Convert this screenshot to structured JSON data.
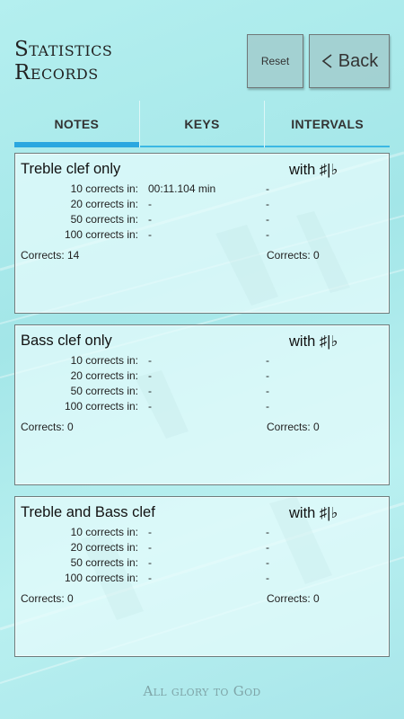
{
  "header": {
    "title_line1": "Statistics",
    "title_line2": "Records",
    "reset_label": "Reset",
    "back_label": "Back"
  },
  "tabs": [
    {
      "label": "NOTES",
      "active": true
    },
    {
      "label": "KEYS",
      "active": false
    },
    {
      "label": "INTERVALS",
      "active": false
    }
  ],
  "cards": [
    {
      "title": "Treble clef only",
      "with_label": "with ♯|♭",
      "rows": [
        {
          "label": "10 corrects in:",
          "plain": "00:11.104 min",
          "accidental": "-"
        },
        {
          "label": "20 corrects in:",
          "plain": "-",
          "accidental": "-"
        },
        {
          "label": "50 corrects in:",
          "plain": "-",
          "accidental": "-"
        },
        {
          "label": "100 corrects in:",
          "plain": "-",
          "accidental": "-"
        }
      ],
      "corrects_plain": "Corrects:  14",
      "corrects_accidental": "Corrects:  0"
    },
    {
      "title": "Bass clef only",
      "with_label": "with ♯|♭",
      "rows": [
        {
          "label": "10 corrects in:",
          "plain": "-",
          "accidental": "-"
        },
        {
          "label": "20 corrects in:",
          "plain": "-",
          "accidental": "-"
        },
        {
          "label": "50 corrects in:",
          "plain": "-",
          "accidental": "-"
        },
        {
          "label": "100 corrects in:",
          "plain": "-",
          "accidental": "-"
        }
      ],
      "corrects_plain": "Corrects:  0",
      "corrects_accidental": "Corrects:  0"
    },
    {
      "title": "Treble and Bass clef",
      "with_label": "with ♯|♭",
      "rows": [
        {
          "label": "10 corrects in:",
          "plain": "-",
          "accidental": "-"
        },
        {
          "label": "20 corrects in:",
          "plain": "-",
          "accidental": "-"
        },
        {
          "label": "50 corrects in:",
          "plain": "-",
          "accidental": "-"
        },
        {
          "label": "100 corrects in:",
          "plain": "-",
          "accidental": "-"
        }
      ],
      "corrects_plain": "Corrects:  0",
      "corrects_accidental": "Corrects:  0"
    }
  ],
  "footer": {
    "text": "All glory to God"
  },
  "icons": {
    "back": "chevron-left-icon"
  },
  "colors": {
    "accent": "#2aa7e0",
    "background": "#aeeaec"
  }
}
